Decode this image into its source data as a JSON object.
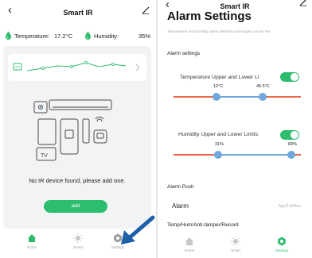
{
  "left": {
    "header": {
      "back_icon": "chevron-left-icon",
      "title": "Smart IR",
      "edit_icon": "edit-icon"
    },
    "sensors": {
      "temperature_label": "Temperature:",
      "temperature_value": "17.2°C",
      "humidity_label": "Humidity:",
      "humidity_value": "35%"
    },
    "empty_message": "No IR device found, please add one.",
    "add_button": "add",
    "tabs": [
      {
        "label": "Home",
        "icon": "home-icon"
      },
      {
        "label": "Smart",
        "icon": "sun-icon"
      },
      {
        "label": "Settings",
        "icon": "gear-icon"
      }
    ]
  },
  "right": {
    "header": {
      "back_icon": "chevron-left-icon",
      "title": "Smart IR",
      "edit_icon": "edit-icon"
    },
    "page_title": "Alarm Settings",
    "description": "Temperature and humidity alarm switches and ranges can be set.",
    "section_alarm_settings": "Alarm settings",
    "temperature_limits": {
      "label": "Temperature Upper and Lower Li",
      "low": "12°C",
      "high": "45.5°C"
    },
    "humidity_limits": {
      "label": "Humidity Upper and Lower Limits",
      "low": "31%",
      "high": "83%"
    },
    "section_alarm_push": "Alarm Push",
    "alarm": {
      "label": "Alarm",
      "value": "App/Txt/Mes"
    },
    "section_record": "Temp/Hum/Anti-tamper/Record",
    "tabs": [
      {
        "label": "Home",
        "icon": "home-icon"
      },
      {
        "label": "Smart",
        "icon": "sun-icon"
      },
      {
        "label": "Settings",
        "icon": "gear-icon"
      }
    ]
  },
  "colors": {
    "accent_green": "#2dbd6e",
    "slider_active": "#6fa8dc",
    "slider_inactive": "#e8684a",
    "tab_inactive": "#c8c8c8",
    "pointer_arrow": "#1f5fa8"
  }
}
